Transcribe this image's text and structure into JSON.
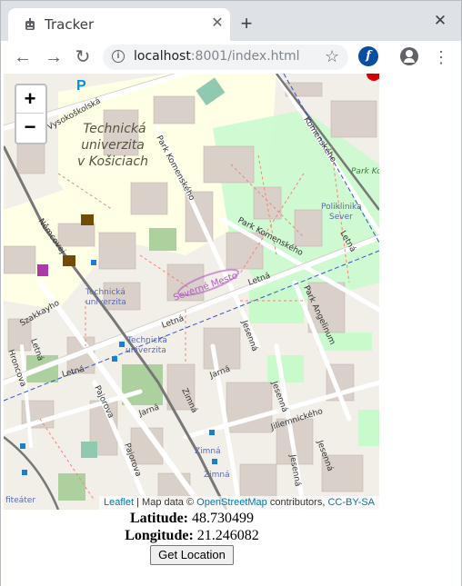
{
  "tab": {
    "title": "Tracker",
    "close_glyph": "✕",
    "favicon": "robot-icon"
  },
  "window": {
    "new_tab_glyph": "+",
    "close_glyph": "✕"
  },
  "toolbar": {
    "url_host": "localhost",
    "url_path": ":8001/index.html",
    "back_glyph": "←",
    "forward_glyph": "→",
    "reload_glyph": "↻",
    "star_glyph": "☆",
    "extension_letter": "f",
    "menu_glyph": "⋮"
  },
  "map": {
    "zoom_in": "+",
    "zoom_out": "−",
    "labels": {
      "university": [
        "Technická",
        "univerzita",
        "v Košiciach"
      ],
      "park_komenskeho_diag": "Park Komenského",
      "park_komenskeho": "Park Komenského",
      "komenskeho": "Komenského",
      "vysokoskolska": "Vysokoškolská",
      "nemcovej": "Němcovej",
      "letna": "Letná",
      "letna2": "Letná",
      "letna3": "Letná",
      "letna4": "Letná",
      "letna5": "Letná",
      "stop_tu1": [
        "Technická",
        "univerzita"
      ],
      "stop_tu2": [
        "Technická",
        "univerzita"
      ],
      "severne_mesto": "Severné Mesto",
      "poliklinika": [
        "Poliklinika",
        "Sever"
      ],
      "park_angelinum": "Park Angelinum",
      "park_k": "Park Ko",
      "szakkayho": "Szakkayho",
      "hroncova": "Hroncova",
      "jesenna1": "Jesenná",
      "jesenna2": "Jesenná",
      "jesenna3": "Jesenná",
      "jesenna4": "Jesenná",
      "jarna1": "Jarná",
      "jarna2": "Jarná",
      "zimna1": "Zimná",
      "zimna2": "Zimná",
      "zimna3": "Zimná",
      "pajorova1": "Pajorova",
      "pajorova2": "Pajorova",
      "jiliemnickeho": "Jiliemnického",
      "fiteater": "fiteáter",
      "parking": "P"
    },
    "attribution": {
      "leaflet": "Leaflet",
      "sep": " | Map data © ",
      "osm": "OpenStreetMap",
      "contrib": " contributors, ",
      "license": "CC-BY-SA"
    }
  },
  "location": {
    "lat_label": "Latitude:",
    "lat_value": " 48.730499",
    "lon_label": "Longitude:",
    "lon_value": " 21.246082",
    "button": "Get Location"
  }
}
